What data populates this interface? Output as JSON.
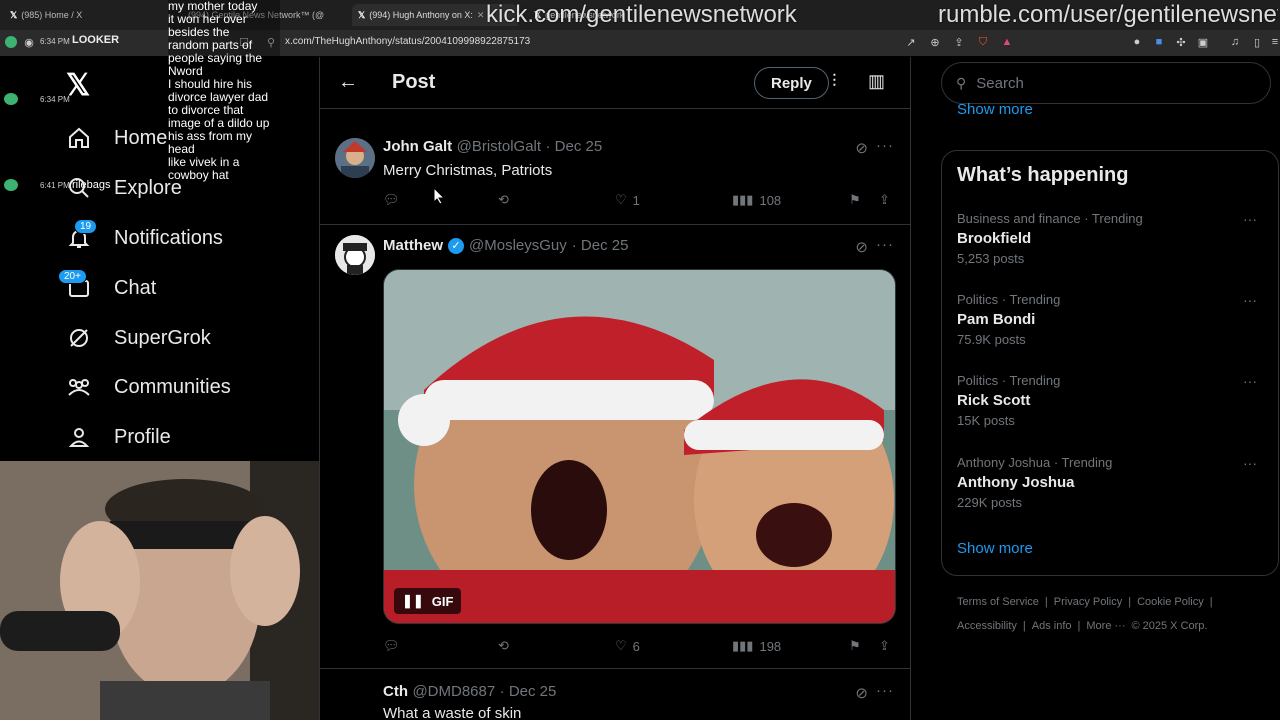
{
  "browser": {
    "tabs": [
      {
        "label": "(985) Home / X"
      },
      {
        "label": "(994) Gentile News Network™ (@"
      },
      {
        "label": "(994) Hugh Anthony on X:"
      },
      {
        "label": "gentilenewsnetwork"
      }
    ],
    "url": "x.com/TheHughAnthony/status/2004109998922875173",
    "looker_label": "LOOKER",
    "side_time_1": "6:34 PM",
    "side_time_2": "6:34 PM",
    "side_time_3": "6:41 PM",
    "side_user_label": "rilebags"
  },
  "overlay": {
    "kick": "kick.com/gentilenewsnetwork",
    "rumble": "rumble.com/user/gentilenewsnet",
    "chat_lines": [
      "my mother today",
      "it won her over",
      "besides the",
      "random parts of",
      "people saying the",
      "Nword",
      "I should hire his",
      "divorce lawyer dad",
      "to divorce that",
      "image of a dildo up",
      "his ass from my",
      "head",
      "like vivek in a",
      "cowboy hat"
    ]
  },
  "nav": {
    "home": "Home",
    "explore": "Explore",
    "notifications": "Notifications",
    "notifications_badge": "19",
    "chat": "Chat",
    "chat_badge": "20+",
    "supergrok": "SuperGrok",
    "communities": "Communities",
    "profile": "Profile"
  },
  "header": {
    "title": "Post",
    "reply_button": "Reply"
  },
  "tweets": [
    {
      "name": "John Galt",
      "handle": "@BristolGalt",
      "date": "· Dec 25",
      "text": "Merry Christmas, Patriots",
      "likes": "1",
      "views": "108"
    },
    {
      "name": "Matthew",
      "handle": "@MosleysGuy",
      "date": "· Dec 25",
      "text": "",
      "gif_label": "GIF",
      "likes": "6",
      "views": "198"
    },
    {
      "name": "Cth",
      "handle": "@DMD8687",
      "date": "· Dec 25",
      "text": "What a waste of skin"
    }
  ],
  "sidebar": {
    "search_placeholder": "Search",
    "show_more_top": "Show more",
    "whats_happening": "What’s happening",
    "trends": [
      {
        "category": "Business and finance · Trending",
        "title": "Brookfield",
        "count": "5,253 posts"
      },
      {
        "category": "Politics · Trending",
        "title": "Pam Bondi",
        "count": "75.9K posts"
      },
      {
        "category": "Politics · Trending",
        "title": "Rick Scott",
        "count": "15K posts"
      },
      {
        "category": "Anthony Joshua · Trending",
        "title": "Anthony Joshua",
        "count": "229K posts"
      }
    ],
    "show_more": "Show more",
    "footer": {
      "terms": "Terms of Service",
      "privacy": "Privacy Policy",
      "cookie": "Cookie Policy",
      "accessibility": "Accessibility",
      "ads": "Ads info",
      "more": "More ···",
      "copyright": "© 2025 X Corp."
    }
  },
  "colors": {
    "accent": "#1d9bf0",
    "background": "#000000",
    "muted": "#71767b",
    "border": "#2f3336"
  }
}
